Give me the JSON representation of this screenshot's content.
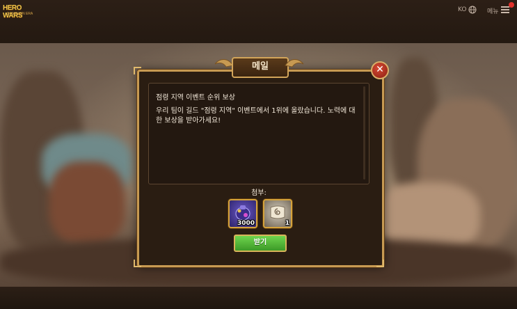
{
  "header": {
    "logo_line1": "HERO WARS",
    "logo_line2": "DOMINION ERA",
    "language": "KO",
    "menu_label": "메뉴"
  },
  "dialog": {
    "title": "메일",
    "close_icon": "close-icon",
    "subject": "점령 지역 이벤트 순위 보상",
    "body": "우리 팀이 길드 \"점령 지역\" 이벤트에서 1위에 올랐습니다. 노력에 대한 보상을 받아가세요!",
    "attachments_label": "첨부:",
    "attachments": [
      {
        "icon": "potion-bag-icon",
        "quantity": "3000"
      },
      {
        "icon": "scroll-icon",
        "quantity": "1"
      }
    ],
    "claim_label": "받기"
  },
  "colors": {
    "frame_gold": "#c79a52",
    "claim_green": "#4fb534",
    "close_red": "#b8321f"
  }
}
